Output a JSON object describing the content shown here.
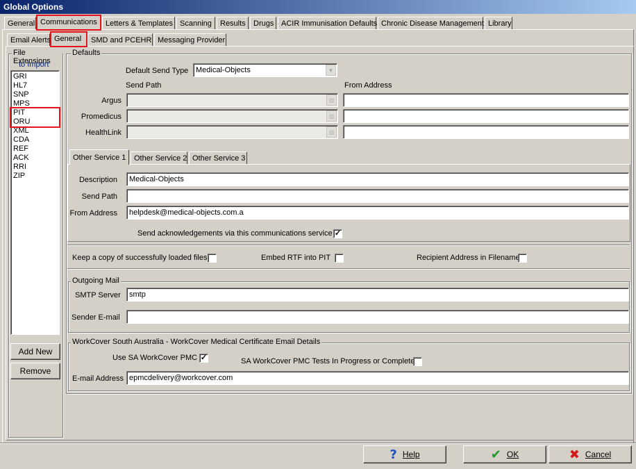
{
  "window": {
    "title": "Global Options"
  },
  "main_tabs": [
    {
      "label": "General"
    },
    {
      "label": "Communications"
    },
    {
      "label": "Letters & Templates"
    },
    {
      "label": "Scanning"
    },
    {
      "label": "Results"
    },
    {
      "label": "Drugs"
    },
    {
      "label": "ACIR Immunisation Defaults"
    },
    {
      "label": "Chronic Disease Management"
    },
    {
      "label": "Library"
    }
  ],
  "sub_tabs": [
    {
      "label": "Email Alerts"
    },
    {
      "label": "General"
    },
    {
      "label": "SMD and PCEHR"
    },
    {
      "label": "Messaging Provider"
    }
  ],
  "file_extensions": {
    "label_line1": "File Extensions",
    "label_line2": "to Import",
    "items": [
      "GRI",
      "HL7",
      "SNP",
      "MPS",
      "PIT",
      "ORU",
      "XML",
      "CDA",
      "REF",
      "ACK",
      "RRI",
      "ZIP"
    ],
    "add_new_label": "Add New",
    "remove_label": "Remove"
  },
  "defaults": {
    "group_label": "Defaults",
    "default_send_type_label": "Default Send Type",
    "default_send_type_value": "Medical-Objects",
    "send_path_header": "Send Path",
    "from_address_header": "From Address",
    "rows": [
      {
        "label": "Argus",
        "send_path": "",
        "from_address": ""
      },
      {
        "label": "Promedicus",
        "send_path": "",
        "from_address": ""
      },
      {
        "label": "HealthLink",
        "send_path": "",
        "from_address": ""
      }
    ]
  },
  "other_service_tabs": [
    {
      "label": "Other Service 1"
    },
    {
      "label": "Other Service 2"
    },
    {
      "label": "Other Service 3"
    }
  ],
  "other_service": {
    "description_label": "Description",
    "description_value": "Medical-Objects",
    "send_path_label": "Send Path",
    "send_path_value": "",
    "from_address_label": "From Address",
    "from_address_value": "helpdesk@medical-objects.com.a",
    "ack_label": "Send acknowledgements via this communications service",
    "ack_checked": "✓"
  },
  "options": {
    "keep_copy_label": "Keep a copy of successfully loaded files",
    "embed_rtf_label": "Embed RTF into PIT",
    "recipient_address_label": "Recipient Address in Filename"
  },
  "outgoing_mail": {
    "group_label": "Outgoing Mail",
    "smtp_label": "SMTP Server",
    "smtp_value": "smtp",
    "sender_label": "Sender E-mail",
    "sender_value": ""
  },
  "workcover": {
    "group_label": "WorkCover South Australia - WorkCover Medical Certificate Email Details",
    "use_pmc_label": "Use SA WorkCover PMC",
    "use_pmc_checked": "✓",
    "tests_label": "SA WorkCover PMC Tests In Progress or Complete",
    "email_label": "E-mail Address",
    "email_value": "epmcdelivery@workcover.com"
  },
  "footer": {
    "help_label": "Help",
    "ok_label": "OK",
    "cancel_label": "Cancel",
    "help_glyph": "?",
    "ok_glyph": "✔",
    "cancel_glyph": "✖"
  },
  "colors": {
    "highlight": "#e5141b",
    "titlebar_start": "#0a246a",
    "face": "#d4d0c8"
  }
}
